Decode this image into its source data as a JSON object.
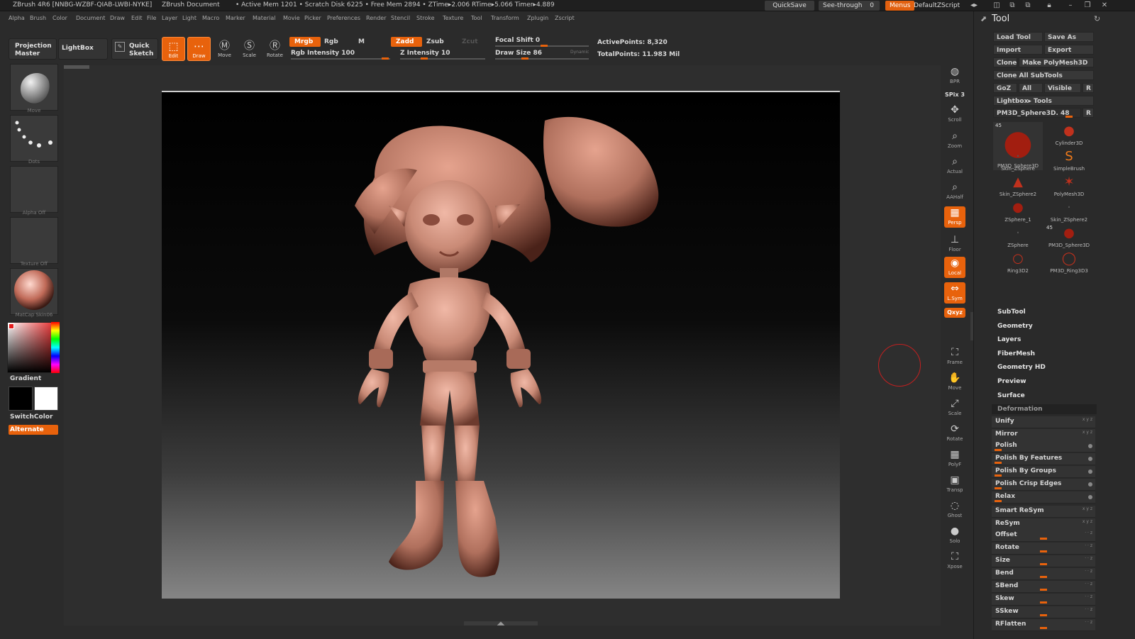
{
  "titlebar": {
    "app": "ZBrush 4R6 [NNBG-WZBF-QIAB-LWBI-NYKE]",
    "document": "ZBrush Document",
    "stats": "• Active Mem 1201 • Scratch Disk 6225 • Free Mem 2894 • ZTime▸2.006 RTime▸5.066 Timer▸4.889",
    "quicksave": "QuickSave",
    "see_through": "See-through",
    "see_through_value": "0",
    "menus": "Menus",
    "script": "DefaultZScript"
  },
  "menubar": [
    "Alpha",
    "Brush",
    "Color",
    "Document",
    "Draw",
    "Edit",
    "File",
    "Layer",
    "Light",
    "Macro",
    "Marker",
    "Material",
    "Movie",
    "Picker",
    "Preferences",
    "Render",
    "Stencil",
    "Stroke",
    "Texture",
    "Tool",
    "Transform",
    "Zplugin",
    "Zscript"
  ],
  "shelf": {
    "projection_master": "Projection Master",
    "lightbox": "LightBox",
    "quick_sketch": "Quick Sketch",
    "edit": "Edit",
    "draw": "Draw",
    "move": "Move",
    "scale": "Scale",
    "rotate": "Rotate",
    "mrgb": "Mrgb",
    "rgb": "Rgb",
    "m": "M",
    "rgb_intensity": "Rgb Intensity 100",
    "zadd": "Zadd",
    "zsub": "Zsub",
    "zcut": "Zcut",
    "z_intensity": "Z Intensity 10",
    "focal_shift": "Focal Shift 0",
    "draw_size": "Draw Size 86",
    "dynamic": "Dynamic",
    "active_points": "ActivePoints: 8,320",
    "total_points": "TotalPoints: 11.983 Mil"
  },
  "leftpanel": {
    "brush_caption": "Move",
    "stroke_caption": "Dots",
    "alpha_caption": "Alpha Off",
    "texture_caption": "Texture Off",
    "material_caption": "MatCap Skin06",
    "gradient": "Gradient",
    "switchcolor": "SwitchColor",
    "alternate": "Alternate"
  },
  "rightshelf": [
    {
      "name": "bpr",
      "label": "BPR",
      "icon": "◍",
      "active": false
    },
    {
      "name": "spix",
      "label": "SPix 3",
      "icon": "",
      "active": false
    },
    {
      "name": "scroll",
      "label": "Scroll",
      "icon": "✥",
      "active": false
    },
    {
      "name": "zoom",
      "label": "Zoom",
      "icon": "⌕",
      "active": false
    },
    {
      "name": "actual",
      "label": "Actual",
      "icon": "⌕",
      "active": false
    },
    {
      "name": "aahalf",
      "label": "AAHalf",
      "icon": "⌕",
      "active": false
    },
    {
      "name": "persp",
      "label": "Persp",
      "icon": "▦",
      "active": true
    },
    {
      "name": "floor",
      "label": "Floor",
      "icon": "⊥",
      "active": false
    },
    {
      "name": "local",
      "label": "Local",
      "icon": "◉",
      "active": true
    },
    {
      "name": "lsym",
      "label": "L.Sym",
      "icon": "⇔",
      "active": true
    },
    {
      "name": "xyz",
      "label": "Qxyz",
      "icon": "",
      "active": true
    },
    {
      "name": "frame",
      "label": "Frame",
      "icon": "⛶",
      "active": false
    },
    {
      "name": "move",
      "label": "Move",
      "icon": "✋",
      "active": false
    },
    {
      "name": "scale",
      "label": "Scale",
      "icon": "⤢",
      "active": false
    },
    {
      "name": "rotate",
      "label": "Rotate",
      "icon": "⟳",
      "active": false
    },
    {
      "name": "polyf",
      "label": "PolyF",
      "icon": "▦",
      "active": false
    },
    {
      "name": "transp",
      "label": "Transp",
      "icon": "▣",
      "active": false
    },
    {
      "name": "ghost",
      "label": "Ghost",
      "icon": "◌",
      "active": false
    },
    {
      "name": "solo",
      "label": "Solo",
      "icon": "●",
      "active": false
    },
    {
      "name": "xpose",
      "label": "Xpose",
      "icon": "⛶",
      "active": false
    }
  ],
  "tool": {
    "title": "Tool",
    "load_tool": "Load Tool",
    "save_as": "Save As",
    "import": "Import",
    "export": "Export",
    "clone": "Clone",
    "make_polymesh": "Make PolyMesh3D",
    "clone_all": "Clone All SubTools",
    "goz": "GoZ",
    "all": "All",
    "visible": "Visible",
    "r": "R",
    "lightbox_tools": "Lightbox▸ Tools",
    "current_tool": "PM3D_Sphere3D. 48",
    "thumbs": [
      {
        "label": "PM3D_Sphere3D",
        "count": "45",
        "glyph": "●"
      },
      {
        "label": "Cylinder3D",
        "count": "",
        "glyph": "●"
      },
      {
        "label": "Skin_ZSphere",
        "count": "",
        "glyph": "·"
      },
      {
        "label": "SimpleBrush",
        "count": "",
        "glyph": "S"
      },
      {
        "label": "Skin_ZSphere2",
        "count": "",
        "glyph": "▲"
      },
      {
        "label": "PolyMesh3D",
        "count": "",
        "glyph": "✶"
      },
      {
        "label": "ZSphere_1",
        "count": "",
        "glyph": "●"
      },
      {
        "label": "Skin_ZSphere2",
        "count": "",
        "glyph": "·"
      },
      {
        "label": "ZSphere",
        "count": "",
        "glyph": "·"
      },
      {
        "label": "PM3D_Sphere3D",
        "count": "45",
        "glyph": "●"
      },
      {
        "label": "Ring3D2",
        "count": "",
        "glyph": "○"
      },
      {
        "label": "PM3D_Ring3D3",
        "count": "",
        "glyph": "◯"
      }
    ],
    "sections": [
      "SubTool",
      "Geometry",
      "Layers",
      "FiberMesh",
      "Geometry HD",
      "Preview",
      "Surface",
      "Deformation"
    ],
    "deformation": [
      {
        "label": "Unify",
        "kind": "xyz"
      },
      {
        "label": "Mirror",
        "kind": "xyz"
      },
      {
        "label": "Polish",
        "kind": "dot"
      },
      {
        "label": "Polish By Features",
        "kind": "dot"
      },
      {
        "label": "Polish By Groups",
        "kind": "dot"
      },
      {
        "label": "Polish Crisp Edges",
        "kind": "dot"
      },
      {
        "label": "Relax",
        "kind": "dot"
      },
      {
        "label": "Smart ReSym",
        "kind": "xyz"
      },
      {
        "label": "ReSym",
        "kind": "xyz"
      },
      {
        "label": "Offset",
        "kind": "mid"
      },
      {
        "label": "Rotate",
        "kind": "mid"
      },
      {
        "label": "Size",
        "kind": "mid"
      },
      {
        "label": "Bend",
        "kind": "mid"
      },
      {
        "label": "SBend",
        "kind": "mid"
      },
      {
        "label": "Skew",
        "kind": "mid"
      },
      {
        "label": "SSkew",
        "kind": "mid"
      },
      {
        "label": "RFlatten",
        "kind": "mid"
      }
    ]
  },
  "colors": {
    "accent": "#e8620c",
    "panel": "#2a2a2a",
    "clay": "#c98a76"
  }
}
